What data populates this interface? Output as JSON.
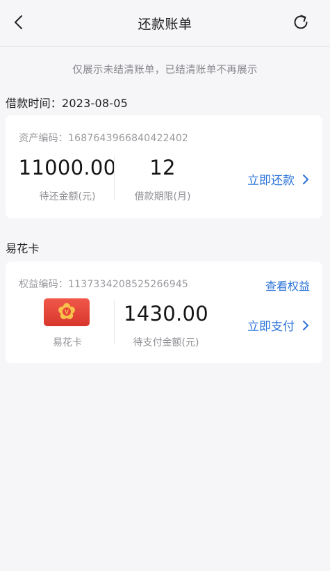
{
  "header": {
    "title": "还款账单",
    "back_icon": "chevron-left-icon",
    "refresh_icon": "refresh-icon"
  },
  "notice": "仅展示未结清账单，已结清账单不再展示",
  "loan_section": {
    "heading": "借款时间：2023-08-05",
    "asset_code": "资产编码：1687643966840422402",
    "amount_value": "11000.00",
    "amount_label": "待还金额(元)",
    "term_value": "12",
    "term_label": "借款期限(月)",
    "action_label": "立即还款"
  },
  "card_section": {
    "heading": "易花卡",
    "benefit_code": "权益编码：1137334208525266945",
    "view_benefits_label": "查看权益",
    "card_name": "易花卡",
    "pay_value": "1430.00",
    "pay_label": "待支付金额(元)",
    "action_label": "立即支付"
  },
  "colors": {
    "accent": "#2a72d8",
    "card_red": "#e8443a",
    "card_yellow": "#f5b61d"
  }
}
